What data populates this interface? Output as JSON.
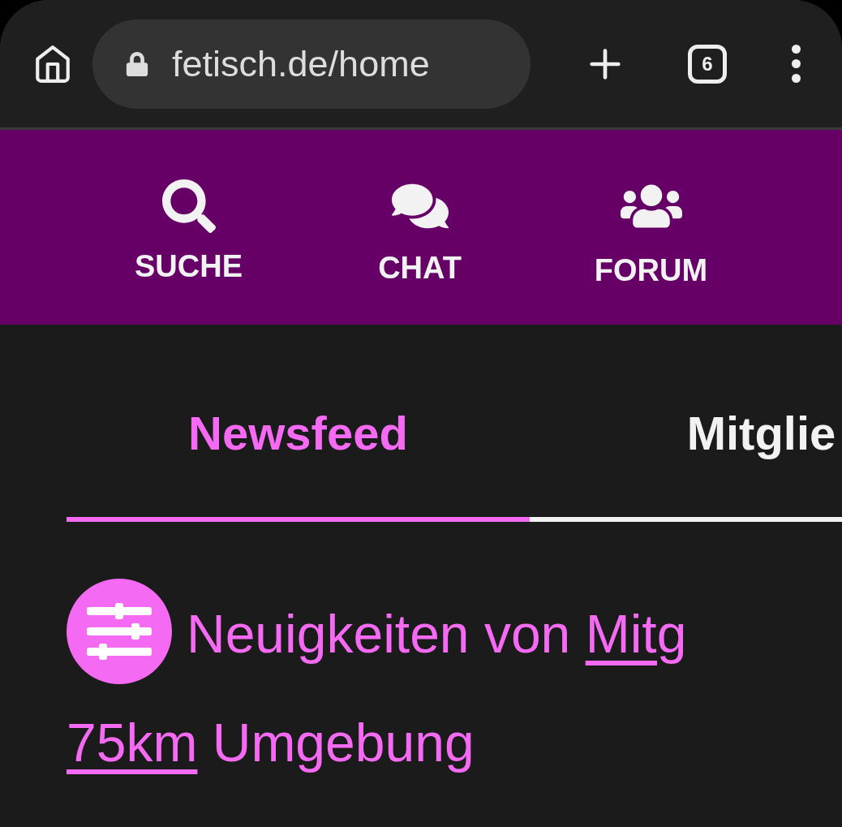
{
  "browser": {
    "url": "fetisch.de/home",
    "tab_count": "6"
  },
  "nav": [
    {
      "kind": "search",
      "label": "SUCHE"
    },
    {
      "kind": "chat",
      "label": "CHAT"
    },
    {
      "kind": "forum",
      "label": "FORUM"
    }
  ],
  "tabs": [
    {
      "label": "Newsfeed",
      "selected": true
    },
    {
      "label": "Mitglie",
      "selected": false
    }
  ],
  "heading": {
    "text": "Neuigkeiten von ",
    "link": "Mitg",
    "link_2": "75km",
    "text_2": " Umgebung"
  }
}
